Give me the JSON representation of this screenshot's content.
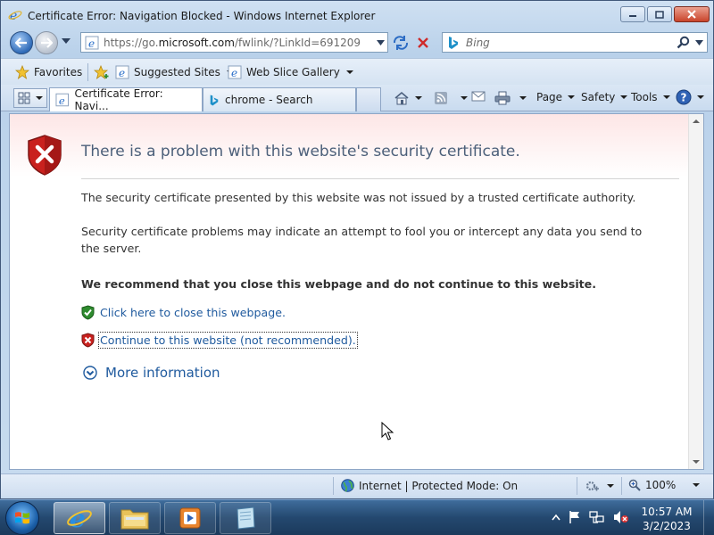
{
  "window": {
    "title": "Certificate Error: Navigation Blocked - Windows Internet Explorer"
  },
  "address_bar": {
    "url_prefix": "https://go.",
    "url_host": "microsoft.com",
    "url_path": "/fwlink/?LinkId=691209"
  },
  "search": {
    "placeholder": "Bing"
  },
  "favorites_bar": {
    "favorites_label": "Favorites",
    "suggested_sites_label": "Suggested Sites",
    "web_slice_label": "Web Slice Gallery"
  },
  "tabs": [
    {
      "label": "Certificate Error: Navi..."
    },
    {
      "label": "chrome - Search"
    }
  ],
  "command_bar": {
    "page_label": "Page",
    "safety_label": "Safety",
    "tools_label": "Tools"
  },
  "content": {
    "heading": "There is a problem with this website's security certificate.",
    "para1": "The security certificate presented by this website was not issued by a trusted certificate authority.",
    "para2": "Security certificate problems may indicate an attempt to fool you or intercept any data you send to the server.",
    "recommendation": "We recommend that you close this webpage and do not continue to this website.",
    "close_link": "Click here to close this webpage.",
    "continue_link": "Continue to this website (not recommended).",
    "more_info": "More information"
  },
  "status_bar": {
    "zone": "Internet | Protected Mode: On",
    "zoom": "100%"
  },
  "taskbar": {
    "time": "10:57 AM",
    "date": "3/2/2023"
  },
  "colors": {
    "link": "#1f5a9e",
    "heading": "#4c607a",
    "shield_red": "#c9211e",
    "shield_green": "#2e8b2e"
  }
}
